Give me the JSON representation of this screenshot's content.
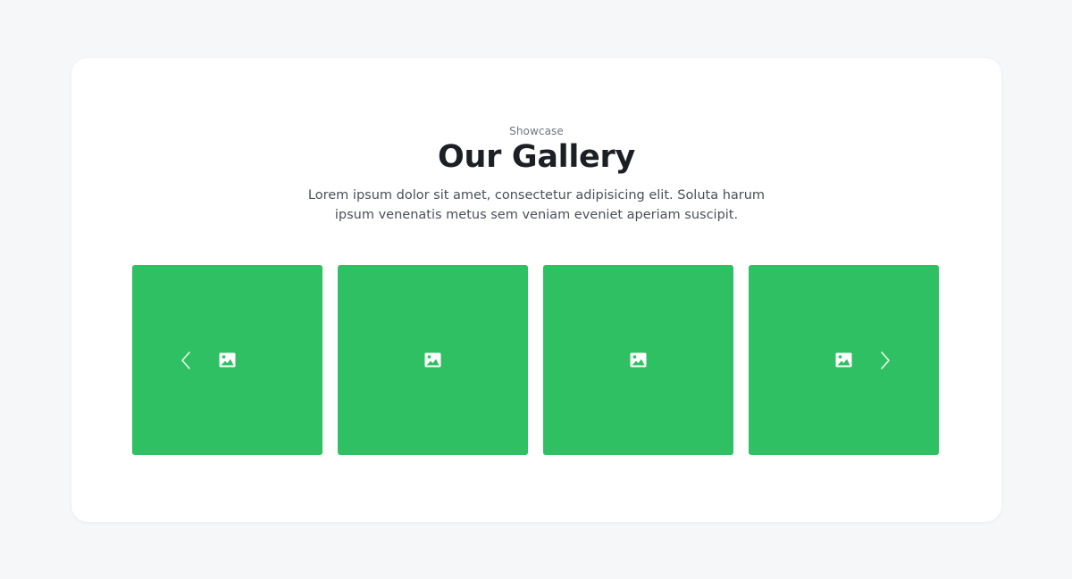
{
  "section": {
    "eyebrow": "Showcase",
    "title": "Our Gallery",
    "description": "Lorem ipsum dolor sit amet, consectetur adipisicing elit. Soluta harum ipsum venenatis metus sem veniam eveniet aperiam suscipit."
  },
  "gallery": {
    "tile_color": "#2ec062",
    "items": [
      {
        "icon": "image-icon"
      },
      {
        "icon": "image-icon"
      },
      {
        "icon": "image-icon"
      },
      {
        "icon": "image-icon"
      }
    ],
    "prev_icon": "chevron-left-icon",
    "next_icon": "chevron-right-icon"
  },
  "colors": {
    "page_background": "#f6f7f9",
    "card_background": "#ffffff",
    "title": "#1c1f24",
    "body_text": "#4a505a",
    "eyebrow_text": "#6f7680"
  }
}
